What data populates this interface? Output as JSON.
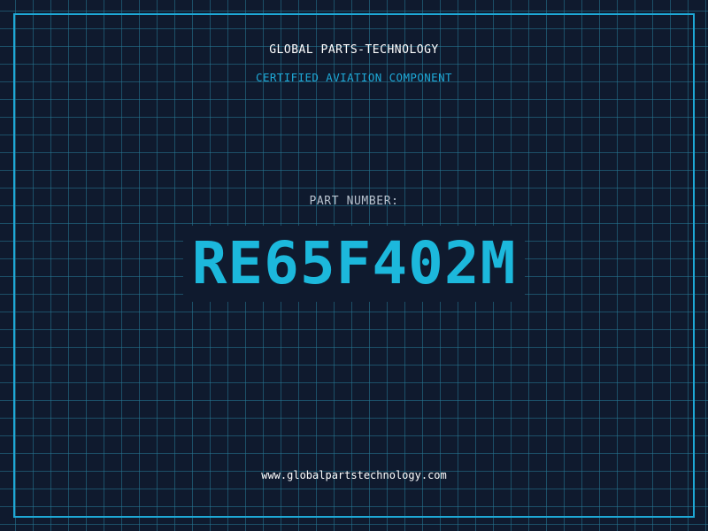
{
  "header": {
    "company": "GLOBAL PARTS-TECHNOLOGY",
    "subtitle": "CERTIFIED AVIATION COMPONENT"
  },
  "part": {
    "label": "PART NUMBER:",
    "number": "RE65F402M"
  },
  "footer": {
    "website": "www.globalpartstechnology.com"
  },
  "colors": {
    "background": "#0f1a2e",
    "grid": "#267a96",
    "accent": "#1ea8d6",
    "part_number": "#1cb8dc",
    "label": "#b9c3cf"
  }
}
